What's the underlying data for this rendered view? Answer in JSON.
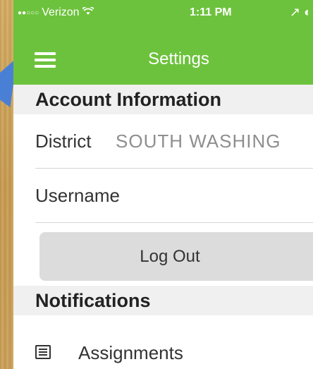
{
  "status_bar": {
    "signal": "●●○○○",
    "carrier": "Verizon",
    "wifi_icon": "wifi-icon",
    "time": "1:11 PM",
    "right_icons": "↗ ◐"
  },
  "nav": {
    "title": "Settings",
    "menu_icon": "hamburger-menu-icon"
  },
  "account": {
    "header": "Account Information",
    "district_label": "District",
    "district_value": "SOUTH WASHING",
    "username_label": "Username",
    "logout_label": "Log Out"
  },
  "notifications": {
    "header": "Notifications",
    "assignments_label": "Assignments",
    "assignments_icon": "list-icon"
  },
  "colors": {
    "accent": "#6dc23d",
    "button": "#dcdcdc"
  }
}
